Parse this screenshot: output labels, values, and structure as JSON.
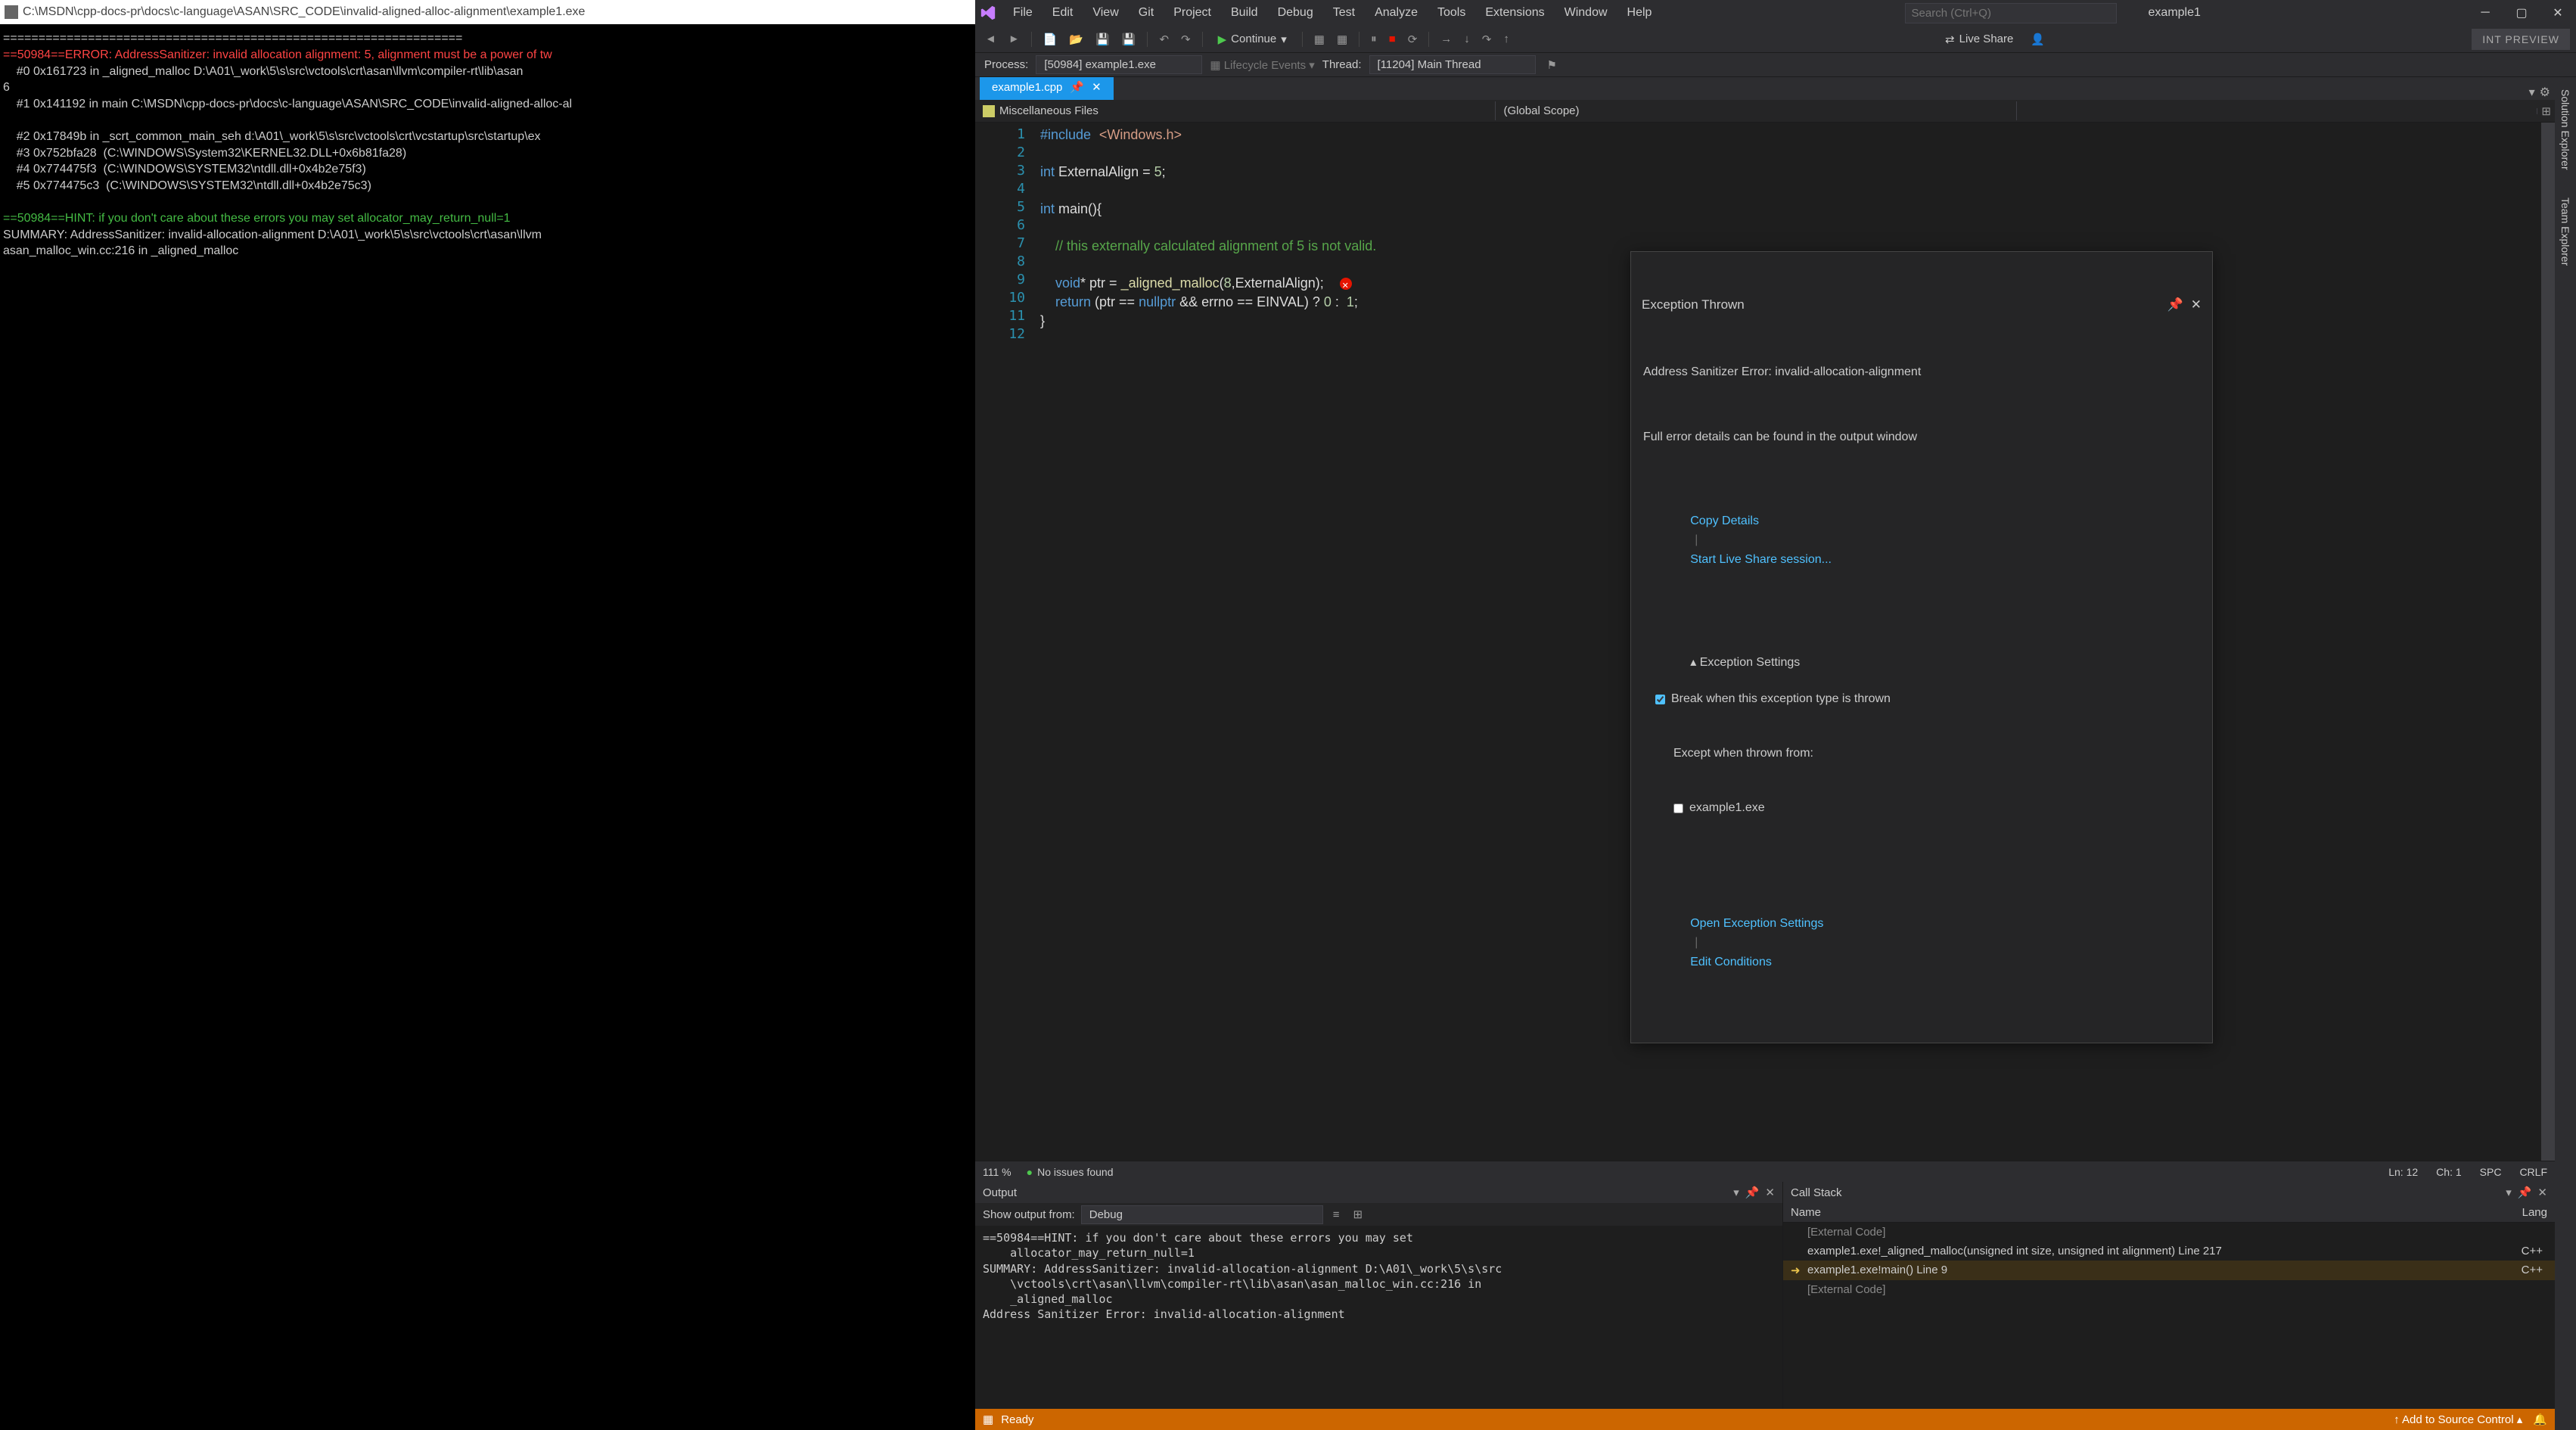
{
  "console": {
    "title": "C:\\MSDN\\cpp-docs-pr\\docs\\c-language\\ASAN\\SRC_CODE\\invalid-aligned-alloc-alignment\\example1.exe",
    "lines_pre": "=================================================================",
    "err_prefix": "==50984==ERROR:",
    "err_body": " AddressSanitizer: invalid allocation alignment: 5, alignment must be a power of tw",
    "trace0": "    #0 0x161723 in _aligned_malloc D:\\A01\\_work\\5\\s\\src\\vctools\\crt\\asan\\llvm\\compiler-rt\\lib\\asan",
    "trace0b": "6",
    "trace1": "    #1 0x141192 in main C:\\MSDN\\cpp-docs-pr\\docs\\c-language\\ASAN\\SRC_CODE\\invalid-aligned-alloc-al",
    "trace2": "    #2 0x17849b in _scrt_common_main_seh d:\\A01\\_work\\5\\s\\src\\vctools\\crt\\vcstartup\\src\\startup\\ex",
    "trace3": "    #3 0x752bfa28  (C:\\WINDOWS\\System32\\KERNEL32.DLL+0x6b81fa28)",
    "trace4": "    #4 0x774475f3  (C:\\WINDOWS\\SYSTEM32\\ntdll.dll+0x4b2e75f3)",
    "trace5": "    #5 0x774475c3  (C:\\WINDOWS\\SYSTEM32\\ntdll.dll+0x4b2e75c3)",
    "hint": "==50984==HINT: if you don't care about these errors you may set allocator_may_return_null=1",
    "summary": "SUMMARY: AddressSanitizer: invalid-allocation-alignment D:\\A01\\_work\\5\\s\\src\\vctools\\crt\\asan\\llvm",
    "summary2": "asan_malloc_win.cc:216 in _aligned_malloc"
  },
  "menu": [
    "File",
    "Edit",
    "View",
    "Git",
    "Project",
    "Build",
    "Debug",
    "Test",
    "Analyze",
    "Tools",
    "Extensions",
    "Window",
    "Help"
  ],
  "search_placeholder": "Search (Ctrl+Q)",
  "solution_name": "example1",
  "continue_label": "Continue",
  "liveshare_label": "Live Share",
  "int_preview": "INT PREVIEW",
  "debug_bar": {
    "process_label": "Process:",
    "process_value": "[50984] example1.exe",
    "lifecycle": "Lifecycle Events",
    "thread_label": "Thread:",
    "thread_value": "[11204] Main Thread"
  },
  "tab_name": "example1.cpp",
  "nav1": "Miscellaneous Files",
  "nav2": "(Global Scope)",
  "code": {
    "l1": "#include <Windows.h>",
    "l3a": "int",
    "l3b": " ExternalAlign = ",
    "l3c": "5",
    "l3d": ";",
    "l5a": "int",
    "l5b": " main(){",
    "l7": "    // this externally calculated alignment of 5 is not valid.",
    "l9a": "    void",
    "l9b": "* ptr = ",
    "l9c": "_aligned_malloc",
    "l9d": "(",
    "l9e": "8",
    "l9f": ",ExternalAlign);",
    "l10a": "    return",
    "l10b": " (ptr == ",
    "l10c": "nullptr",
    "l10d": " && errno == EINVAL) ? ",
    "l10e": "0",
    "l10f": " : ",
    "l10g": " 1",
    "l10h": ";",
    "l11": "}"
  },
  "exception": {
    "title": "Exception Thrown",
    "msg": "Address Sanitizer Error: invalid-allocation-alignment",
    "hint": "Full error details can be found in the output window",
    "copy": "Copy Details",
    "share": "Start Live Share session...",
    "settings": "Exception Settings",
    "break": "Break when this exception type is thrown",
    "except": "Except when thrown from:",
    "exe": "example1.exe",
    "open": "Open Exception Settings",
    "edit": "Edit Conditions"
  },
  "editor_status": {
    "zoom": "111 %",
    "issues": "No issues found",
    "ln": "Ln: 12",
    "ch": "Ch: 1",
    "spc": "SPC",
    "crlf": "CRLF"
  },
  "output": {
    "title": "Output",
    "show_from": "Show output from:",
    "source": "Debug",
    "text": "==50984==HINT: if you don't care about these errors you may set\n    allocator_may_return_null=1\nSUMMARY: AddressSanitizer: invalid-allocation-alignment D:\\A01\\_work\\5\\s\\src\n    \\vctools\\crt\\asan\\llvm\\compiler-rt\\lib\\asan\\asan_malloc_win.cc:216 in\n    _aligned_malloc\nAddress Sanitizer Error: invalid-allocation-alignment"
  },
  "callstack": {
    "title": "Call Stack",
    "col_name": "Name",
    "col_lang": "Lang",
    "rows": [
      {
        "name": "[External Code]",
        "lang": "",
        "ext": true
      },
      {
        "name": "example1.exe!_aligned_malloc(unsigned int size, unsigned int alignment) Line 217",
        "lang": "C++"
      },
      {
        "name": "example1.exe!main() Line 9",
        "lang": "C++",
        "current": true
      },
      {
        "name": "[External Code]",
        "lang": "",
        "ext": true
      }
    ]
  },
  "side_tabs": [
    "Solution Explorer",
    "Team Explorer"
  ],
  "status": {
    "ready": "Ready",
    "source_control": "Add to Source Control"
  }
}
